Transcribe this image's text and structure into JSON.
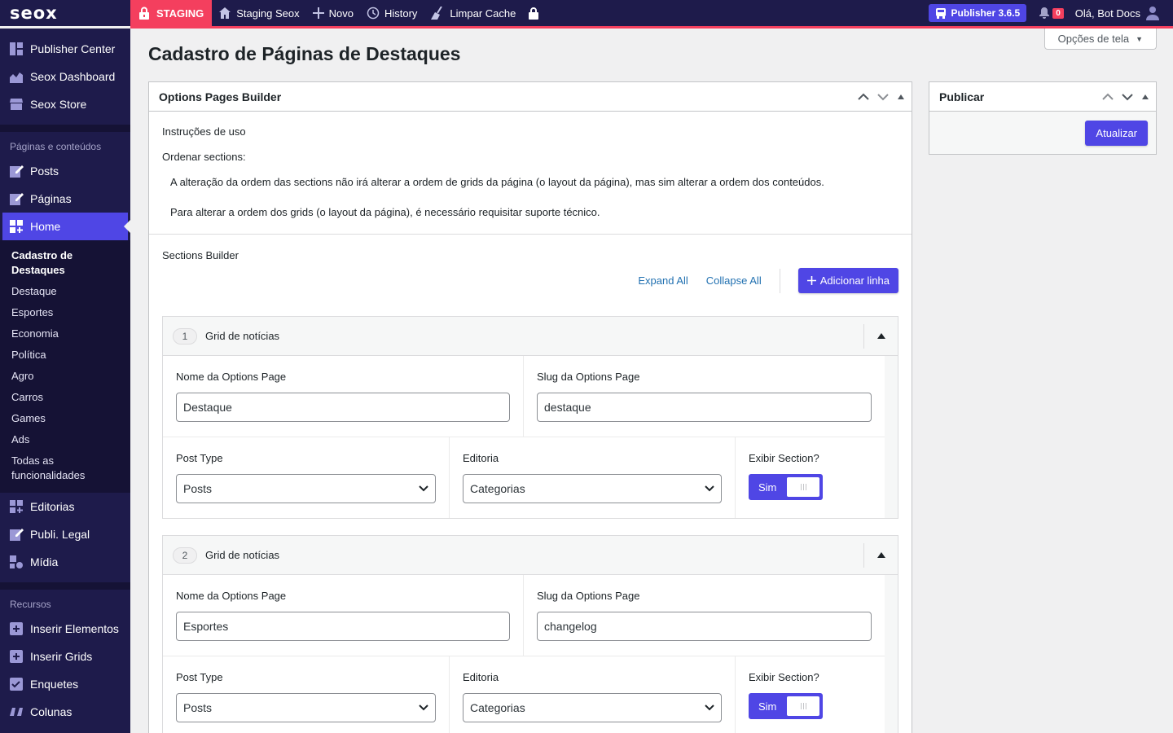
{
  "adminbar": {
    "logo": "seox",
    "staging": "STAGING",
    "items": [
      "Staging Seox",
      "Novo",
      "History",
      "Limpar Cache"
    ],
    "publisher": "Publisher 3.6.5",
    "notifications": "0",
    "greeting": "Olá, Bot Docs"
  },
  "sidebar": {
    "top_items": [
      "Publisher Center",
      "Seox Dashboard",
      "Seox Store"
    ],
    "section1": "Páginas e conteúdos",
    "items1": [
      "Posts",
      "Páginas",
      "Home"
    ],
    "submenu": [
      "Cadastro de Destaques",
      "Destaque",
      "Esportes",
      "Economia",
      "Política",
      "Agro",
      "Carros",
      "Games",
      "Ads",
      "Todas as funcionalidades"
    ],
    "items2": [
      "Editorias",
      "Publi. Legal",
      "Mídia"
    ],
    "section2": "Recursos",
    "items3": [
      "Inserir Elementos",
      "Inserir Grids",
      "Enquetes",
      "Colunas"
    ]
  },
  "page": {
    "screen_options": "Opções de tela",
    "title": "Cadastro de Páginas de Destaques"
  },
  "builder": {
    "title": "Options Pages Builder",
    "instructions_title": "Instruções de uso",
    "order_title": "Ordenar sections:",
    "order_text1": "A alteração da ordem das sections não irá alterar a ordem de grids da página (o layout da página), mas sim alterar a ordem dos conteúdos.",
    "order_text2": "Para alterar a ordem dos grids (o layout da página), é necessário requisitar suporte técnico.",
    "sections_title": "Sections Builder",
    "expand_all": "Expand All",
    "collapse_all": "Collapse All",
    "add_row": "Adicionar linha",
    "labels": {
      "name": "Nome da Options Page",
      "slug": "Slug da Options Page",
      "post_type": "Post Type",
      "editoria": "Editoria",
      "show": "Exibir Section?"
    },
    "rows": [
      {
        "num": "1",
        "title": "Grid de notícias",
        "name": "Destaque",
        "slug": "destaque",
        "post_type": "Posts",
        "editoria": "Categorias",
        "toggle": "Sim"
      },
      {
        "num": "2",
        "title": "Grid de notícias",
        "name": "Esportes",
        "slug": "changelog",
        "post_type": "Posts",
        "editoria": "Categorias",
        "toggle": "Sim"
      }
    ]
  },
  "publish": {
    "title": "Publicar",
    "button": "Atualizar"
  },
  "colors": {
    "accent": "#4f46e5",
    "adminbar": "#1e1b4b",
    "staging": "#f43f5e"
  }
}
